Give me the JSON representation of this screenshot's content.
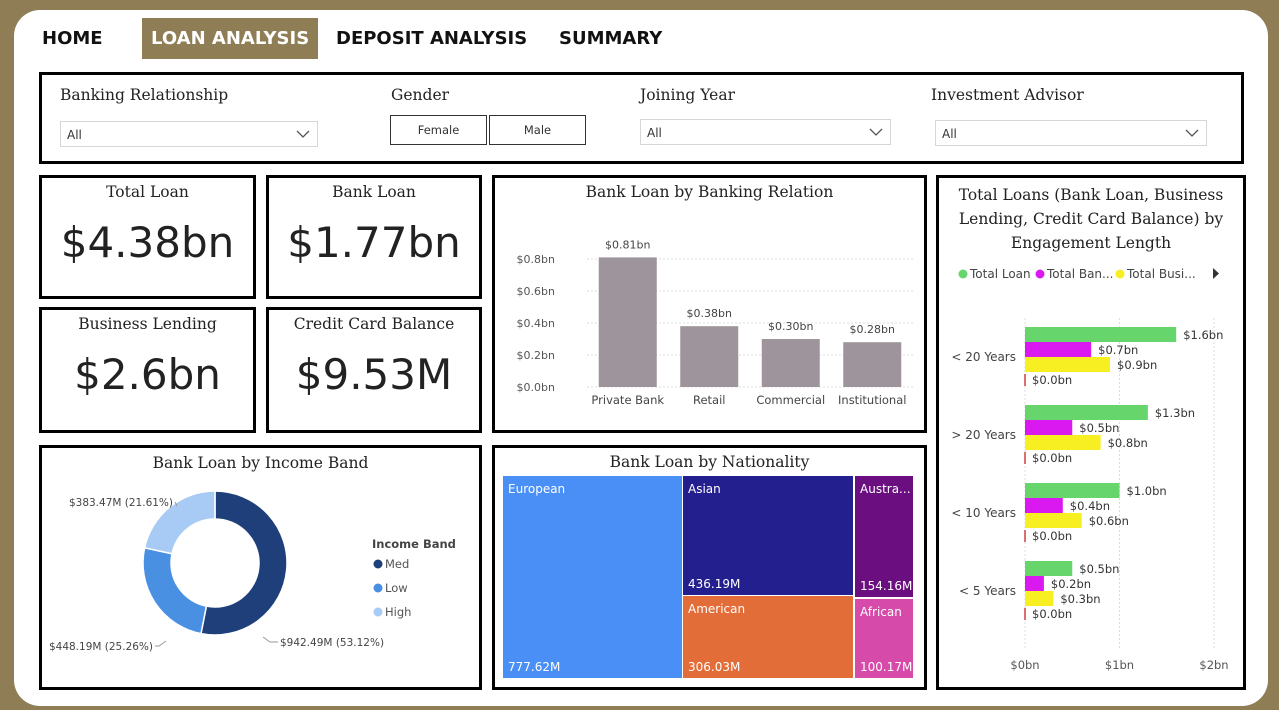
{
  "nav": {
    "home": "HOME",
    "loan_analysis": "LOAN ANALYSIS",
    "deposit_analysis": "DEPOSIT ANALYSIS",
    "summary": "SUMMARY"
  },
  "filters": {
    "banking_relationship": {
      "label": "Banking Relationship",
      "value": "All"
    },
    "gender": {
      "label": "Gender",
      "options": [
        "Female",
        "Male"
      ]
    },
    "joining_year": {
      "label": "Joining Year",
      "value": "All"
    },
    "investment_advisor": {
      "label": "Investment Advisor",
      "value": "All"
    }
  },
  "kpis": {
    "total_loan": {
      "title": "Total Loan",
      "value": "$4.38bn"
    },
    "bank_loan": {
      "title": "Bank Loan",
      "value": "$1.77bn"
    },
    "business_lending": {
      "title": "Business Lending",
      "value": "$2.6bn"
    },
    "credit_card_balance": {
      "title": "Credit Card Balance",
      "value": "$9.53M"
    }
  },
  "chart_data": [
    {
      "id": "bank_loan_by_banking_relation",
      "type": "bar",
      "title": "Bank Loan by Banking Relation",
      "categories": [
        "Private Bank",
        "Retail",
        "Commercial",
        "Institutional"
      ],
      "values": [
        0.81,
        0.38,
        0.3,
        0.28
      ],
      "data_labels": [
        "$0.81bn",
        "$0.38bn",
        "$0.30bn",
        "$0.28bn"
      ],
      "yticks": [
        "$0.0bn",
        "$0.2bn",
        "$0.4bn",
        "$0.6bn",
        "$0.8bn"
      ],
      "ylim": [
        0,
        0.8
      ],
      "color": "#9e949b",
      "grid": true
    },
    {
      "id": "total_loans_by_engagement_length",
      "type": "bar",
      "orientation": "horizontal",
      "title": "Total Loans (Bank Loan, Business Lending, Credit Card Balance) by Engagement Length",
      "legend": [
        "Total Loan",
        "Total Ban...",
        "Total Busi..."
      ],
      "legend_placement": "top",
      "categories": [
        "< 20 Years",
        "> 20 Years",
        "< 10 Years",
        "< 5 Years"
      ],
      "series": [
        {
          "name": "Total Loan",
          "color": "#66d66c",
          "values": [
            1.6,
            1.3,
            1.0,
            0.5
          ],
          "labels": [
            "$1.6bn",
            "$1.3bn",
            "$1.0bn",
            "$0.5bn"
          ]
        },
        {
          "name": "Total Ban...",
          "color": "#d919f0",
          "values": [
            0.7,
            0.5,
            0.4,
            0.2
          ],
          "labels": [
            "$0.7bn",
            "$0.5bn",
            "$0.4bn",
            "$0.2bn"
          ]
        },
        {
          "name": "Total Busi...",
          "color": "#f7ef22",
          "values": [
            0.9,
            0.8,
            0.6,
            0.3
          ],
          "labels": [
            "$0.9bn",
            "$0.8bn",
            "$0.6bn",
            "$0.3bn"
          ]
        },
        {
          "name": "",
          "color": "#d04040",
          "values": [
            0.0,
            0.0,
            0.0,
            0.0
          ],
          "labels": [
            "$0.0bn",
            "$0.0bn",
            "$0.0bn",
            "$0.0bn"
          ]
        }
      ],
      "xticks": [
        "$0bn",
        "$1bn",
        "$2bn"
      ],
      "xlim": [
        0,
        2
      ]
    },
    {
      "id": "bank_loan_by_income_band",
      "type": "pie",
      "donut": true,
      "title": "Bank Loan by Income Band",
      "legend_title": "Income Band",
      "legend_placement": "right",
      "slices": [
        {
          "name": "Med",
          "value": 942.49,
          "percent": 53.12,
          "label": "$942.49M (53.12%)",
          "color": "#1f3f7a"
        },
        {
          "name": "Low",
          "value": 448.19,
          "percent": 25.26,
          "label": "$448.19M (25.26%)",
          "color": "#4a90e2"
        },
        {
          "name": "High",
          "value": 383.47,
          "percent": 21.61,
          "label": "$383.47M (21.61%)",
          "color": "#a8cbf5"
        }
      ]
    },
    {
      "id": "bank_loan_by_nationality",
      "type": "treemap",
      "title": "Bank Loan by Nationality",
      "items": [
        {
          "name": "European",
          "label": "777.62M",
          "value": 777.62,
          "color": "#4a8ff5"
        },
        {
          "name": "Asian",
          "label": "436.19M",
          "value": 436.19,
          "color": "#241f8f"
        },
        {
          "name": "American",
          "label": "306.03M",
          "value": 306.03,
          "color": "#e26d39"
        },
        {
          "name": "Austra...",
          "label": "154.16M",
          "value": 154.16,
          "color": "#6b0f80"
        },
        {
          "name": "African",
          "label": "100.17M",
          "value": 100.17,
          "color": "#d64aa9"
        }
      ]
    }
  ],
  "icons": {
    "dropdown": "chevron-down-icon",
    "legend_more": "caret-right-icon"
  }
}
